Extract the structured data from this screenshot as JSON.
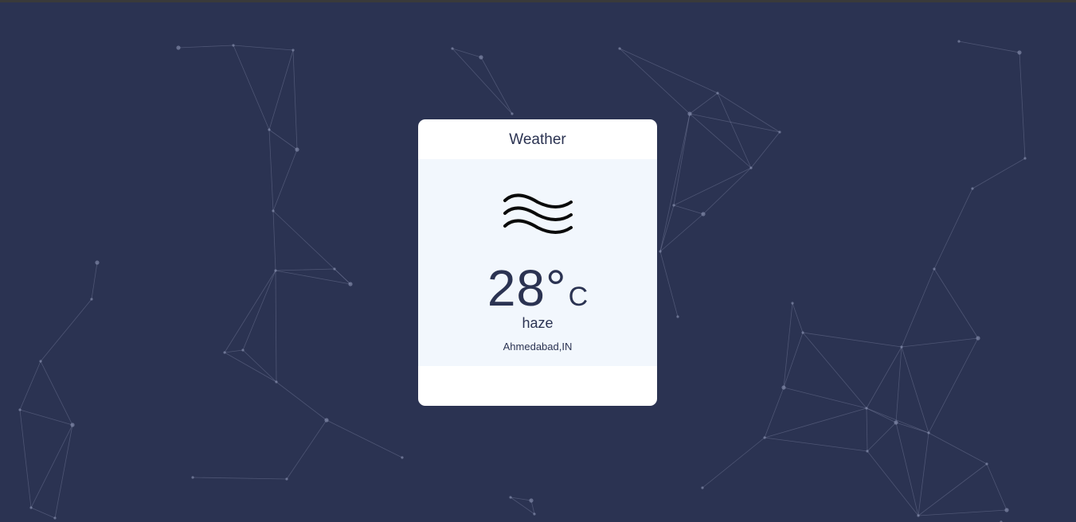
{
  "colors": {
    "background": "#2b3352",
    "card": "#ffffff",
    "card_body": "#f2f7fd",
    "text": "#2b3352",
    "particle": "#8e96b5"
  },
  "card": {
    "title": "Weather",
    "icon": "haze-waves-icon",
    "temperature": "28°",
    "unit": "C",
    "condition": "haze",
    "location": "Ahmedabad,IN"
  }
}
